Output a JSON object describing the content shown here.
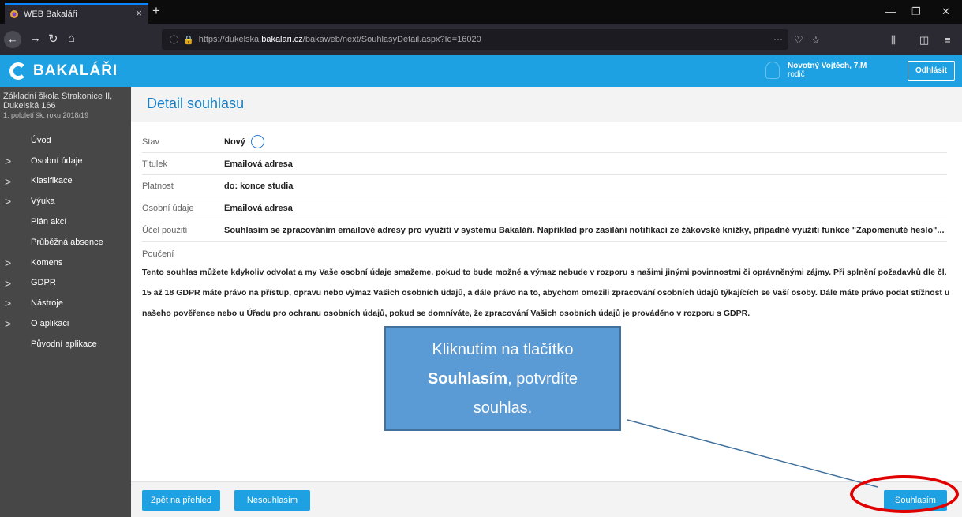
{
  "browser": {
    "tab_title": "WEB Bakaláři",
    "tab_close": "×",
    "new_tab": "+",
    "url_prefix": "https://dukelska.",
    "url_host": "bakalari.cz",
    "url_path": "/bakaweb/next/SouhlasyDetail.aspx?Id=16020",
    "url_dots": "···"
  },
  "app": {
    "logo_text": "BAKALÁŘI",
    "user_name": "Novotný Vojtěch, 7.M",
    "user_role": "rodič",
    "logout_label": "Odhlásit"
  },
  "sidebar": {
    "school_line1": "Základní škola Strakonice II,",
    "school_line2": "Dukelská 166",
    "school_term": "1. pololetí šk. roku 2018/19",
    "items": [
      {
        "label": "Úvod",
        "expandable": false
      },
      {
        "label": "Osobní údaje",
        "expandable": true
      },
      {
        "label": "Klasifikace",
        "expandable": true
      },
      {
        "label": "Výuka",
        "expandable": true
      },
      {
        "label": "Plán akcí",
        "expandable": false
      },
      {
        "label": "Průběžná absence",
        "expandable": false
      },
      {
        "label": "Komens",
        "expandable": true
      },
      {
        "label": "GDPR",
        "expandable": true
      },
      {
        "label": "Nástroje",
        "expandable": true
      },
      {
        "label": "O aplikaci",
        "expandable": true
      },
      {
        "label": "Původní aplikace",
        "expandable": false
      }
    ]
  },
  "detail": {
    "title": "Detail souhlasu",
    "rows": [
      {
        "label": "Stav",
        "value": "Nový"
      },
      {
        "label": "Titulek",
        "value": "Emailová adresa"
      },
      {
        "label": "Platnost",
        "value": "do: konce studia"
      },
      {
        "label": "Osobní údaje",
        "value": "Emailová adresa"
      },
      {
        "label": "Účel použití",
        "value": "Souhlasím se zpracováním emailové adresy pro využití v systému Bakaláři. Například pro zasílání notifikací ze žákovské knížky, případně využití funkce \"Zapomenuté heslo\"..."
      }
    ],
    "pouceni_label": "Poučení",
    "pouceni_text": "Tento souhlas můžete kdykoliv odvolat a my Vaše osobní údaje smažeme, pokud to bude možné a výmaz nebude v rozporu s našimi jinými povinnostmi či oprávněnými zájmy. Při splnění požadavků dle čl. 15 až 18 GDPR máte právo na přístup, opravu nebo výmaz Vašich osobních údajů, a dále právo na to, abychom omezili zpracování osobních údajů týkajících se Vaší osoby. Dále máte právo podat stížnost u našeho pověřence nebo u Úřadu pro ochranu osobních údajů, pokud se domníváte, že zpracování Vašich osobních údajů je prováděno v rozporu s GDPR."
  },
  "footer": {
    "back_label": "Zpět na přehled",
    "decline_label": "Nesouhlasím",
    "agree_label": "Souhlasím"
  },
  "callout": {
    "line1": "Kliknutím na tlačítko",
    "bold": "Souhlasím",
    "line2_rest": ", potvrdíte",
    "line3": "souhlas."
  },
  "colors": {
    "accent": "#1da1e2",
    "sidebar": "#474747",
    "title": "#1980c5",
    "callout": "#5b9bd5",
    "highlight": "#e00000"
  }
}
